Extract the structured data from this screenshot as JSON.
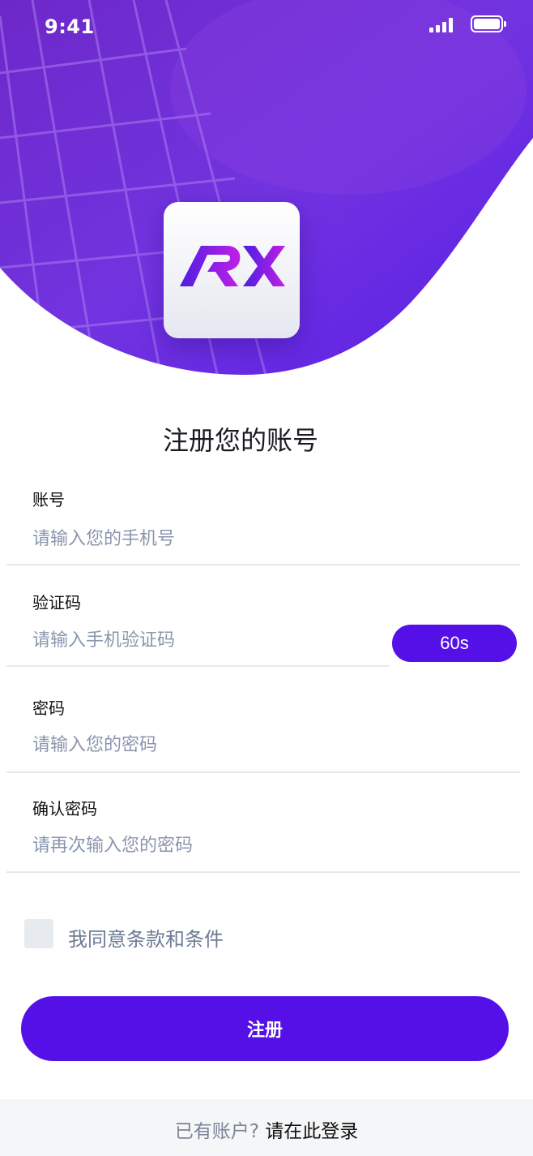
{
  "status_bar": {
    "time": "9:41"
  },
  "colors": {
    "accent": "#5510e8",
    "hero_top": "#7a2fd6",
    "hero_bottom": "#5a1ee0",
    "placeholder": "#8a96ad"
  },
  "logo": {
    "text": "RX"
  },
  "title": "注册您的账号",
  "form": {
    "account": {
      "label": "账号",
      "placeholder": "请输入您的手机号",
      "value": ""
    },
    "code": {
      "label": "验证码",
      "placeholder": "请输入手机验证码",
      "value": "",
      "countdown": "60s"
    },
    "password": {
      "label": "密码",
      "placeholder": "请输入您的密码",
      "value": ""
    },
    "confirm": {
      "label": "确认密码",
      "placeholder": "请再次输入您的密码",
      "value": ""
    }
  },
  "agreement": {
    "label": "我同意条款和条件",
    "checked": false
  },
  "register_button": "注册",
  "footer": {
    "hint": "已有账户?",
    "link": "请在此登录"
  }
}
